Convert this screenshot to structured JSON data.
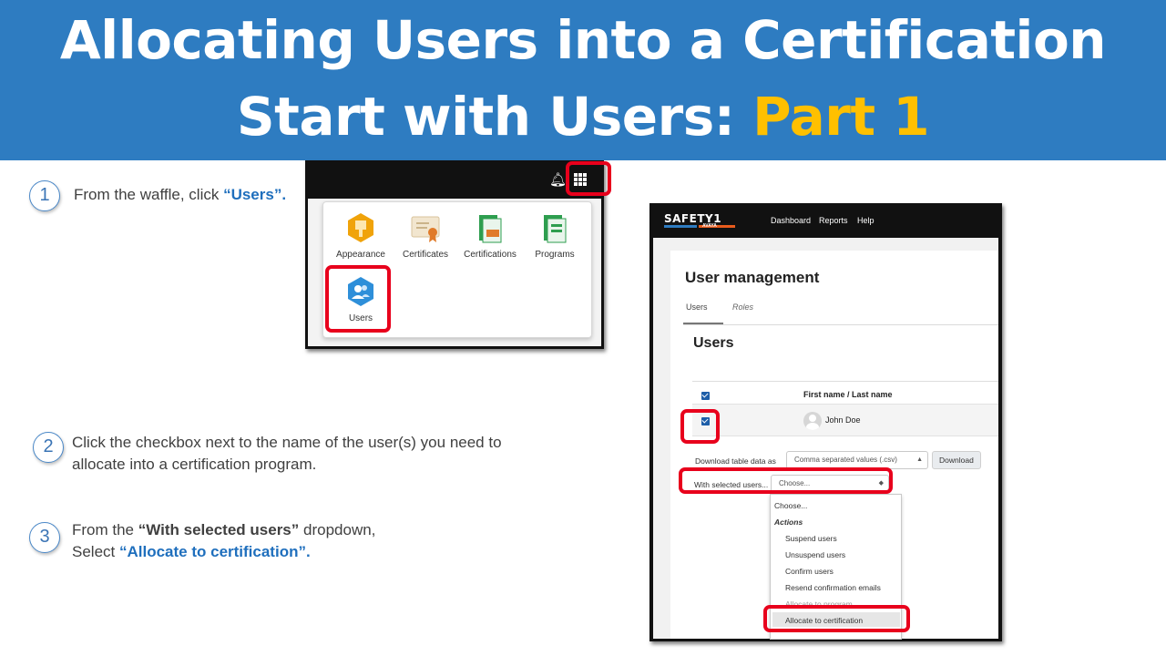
{
  "banner": {
    "line1": "Allocating Users into a Certification",
    "line2_prefix": "Start with Users: ",
    "line2_accent": "Part 1"
  },
  "colors": {
    "banner": "#2e7cc1",
    "accent": "#ffc000",
    "highlight_red": "#e8001c",
    "link_blue": "#1f6fbd"
  },
  "steps": [
    {
      "number": "1",
      "text_prefix": "From the waffle, click ",
      "highlight": "“Users”."
    },
    {
      "number": "2",
      "line1": "Click the checkbox next to the name of the user(s) you need to",
      "line2": "allocate into a certification program."
    },
    {
      "number": "3",
      "line1_prefix": "From the ",
      "line1_highlight": "“With selected users”",
      "line1_suffix": " dropdown,",
      "line2_prefix": "Select ",
      "line2_highlight": "“Allocate to certification”."
    }
  ],
  "waffle_menu": {
    "icons": [
      "bell-icon",
      "waffle-icon"
    ],
    "tiles": [
      {
        "label": "Appearance",
        "icon": "appearance-icon",
        "color": "#f0a30a"
      },
      {
        "label": "Certificates",
        "icon": "certificate-icon",
        "color": "#d9a34a"
      },
      {
        "label": "Certifications",
        "icon": "certifications-icon",
        "color": "#2e9e4f"
      },
      {
        "label": "Programs",
        "icon": "programs-icon",
        "color": "#2e9e4f"
      },
      {
        "label": "Users",
        "icon": "users-icon",
        "color": "#2e8fd9"
      }
    ]
  },
  "user_management": {
    "logo": "SAFETY1",
    "logo_sub": "AVAYA",
    "nav": [
      "Dashboard",
      "Reports",
      "Help"
    ],
    "title": "User management",
    "tabs": [
      "Users",
      "Roles"
    ],
    "section_title": "Users",
    "column_header": "First name / Last name",
    "rows": [
      {
        "name": "John Doe",
        "checked": true
      }
    ],
    "download_label": "Download table data as",
    "download_format": "Comma separated values (.csv)",
    "download_button": "Download",
    "with_selected_label": "With selected users...",
    "with_selected_value": "Choose...",
    "dropdown": {
      "first": "Choose...",
      "group": "Actions",
      "items": [
        "Suspend users",
        "Unsuspend users",
        "Confirm users",
        "Resend confirmation emails",
        "Allocate to program",
        "Allocate to certification"
      ]
    }
  }
}
